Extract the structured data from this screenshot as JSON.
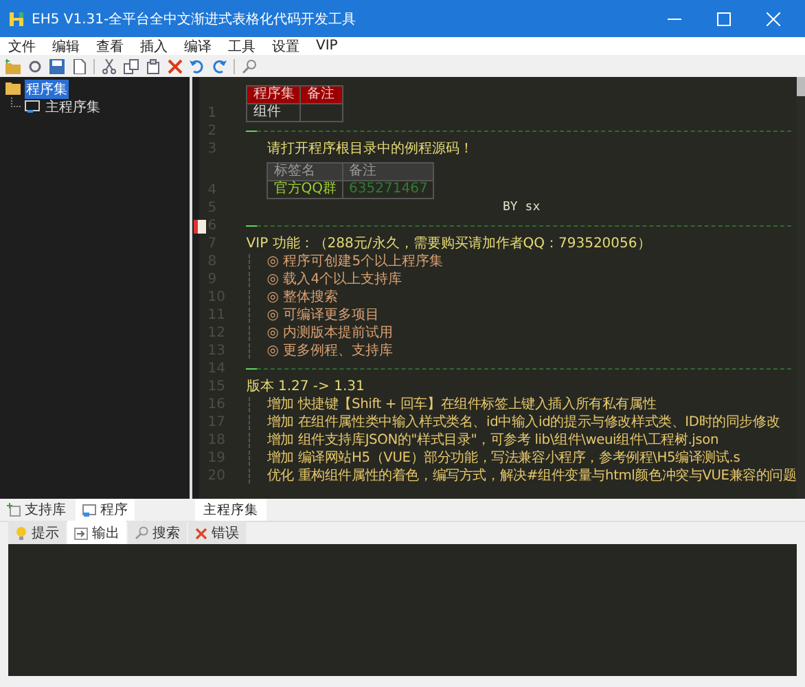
{
  "window": {
    "title": "EH5 V1.31-全平台全中文渐进式表格化代码开发工具"
  },
  "menu": [
    "文件",
    "编辑",
    "查看",
    "插入",
    "编译",
    "工具",
    "设置",
    "VIP"
  ],
  "tree": [
    {
      "label": "程序集",
      "selected": true,
      "children": [
        {
          "label": "主程序集",
          "selected": false
        }
      ]
    }
  ],
  "left_tabs": [
    {
      "label": "支持库",
      "kind": "library",
      "selected": false
    },
    {
      "label": "程序",
      "kind": "program",
      "selected": true
    }
  ],
  "editor_tabs": [
    {
      "label": "主程序集",
      "selected": true
    }
  ],
  "editor": {
    "lines": [
      {
        "kind": "table",
        "number": "1",
        "header": [
          "程序集",
          "备注"
        ],
        "rows": [
          [
            "组件"
          ]
        ]
      },
      {
        "kind": "divider",
        "number": "2",
        "bookmark": false
      },
      {
        "kind": "note",
        "number": "3",
        "text": "请打开程序根目录中的例程源码！"
      },
      {
        "kind": "tag_table",
        "number": "4",
        "header": [
          "标签名",
          "备注"
        ],
        "rows": [
          [
            "官方QQ群",
            "635271467"
          ]
        ]
      },
      {
        "kind": "center",
        "number": "5",
        "text": "BY sx"
      },
      {
        "kind": "divider",
        "number": "6",
        "bookmark": true
      },
      {
        "kind": "heading",
        "number": "7",
        "text": "VIP 功能：（288元/永久，需要购买请加作者QQ：793520056）"
      },
      {
        "kind": "bullet",
        "number": "8",
        "text": "◎ 程序可创建5个以上程序集"
      },
      {
        "kind": "bullet",
        "number": "9",
        "text": "◎ 载入4个以上支持库"
      },
      {
        "kind": "bullet",
        "number": "10",
        "text": "◎ 整体搜索"
      },
      {
        "kind": "bullet",
        "number": "11",
        "text": "◎ 可编译更多项目"
      },
      {
        "kind": "bullet",
        "number": "12",
        "text": "◎ 内测版本提前试用"
      },
      {
        "kind": "bullet",
        "number": "13",
        "text": "◎ 更多例程、支持库"
      },
      {
        "kind": "divider",
        "number": "14",
        "bookmark": false
      },
      {
        "kind": "heading",
        "number": "15",
        "text": "版本 1.27 -> 1.31"
      },
      {
        "kind": "item",
        "number": "16",
        "text": "增加 快捷键【Shift + 回车】在组件标签上键入插入所有私有属性"
      },
      {
        "kind": "item",
        "number": "17",
        "text": "增加 在组件属性类中输入样式类名、id中输入id的提示与修改样式类、ID时的同步修改"
      },
      {
        "kind": "item",
        "number": "18",
        "text": "增加 组件支持库JSON的\"样式目录\"，可参考 lib\\组件\\weui组件\\工程树.json"
      },
      {
        "kind": "item",
        "number": "19",
        "text": "增加 编译网站H5（VUE）部分功能，写法兼容小程序，参考例程\\H5编译测试.s"
      },
      {
        "kind": "item",
        "number": "20",
        "text": "优化 重构组件属性的着色，编写方式，解决#组件变量与html颜色冲突与VUE兼容的问题"
      }
    ]
  },
  "output_tabs": [
    {
      "label": "提示",
      "kind": "hint",
      "selected": false
    },
    {
      "label": "输出",
      "kind": "output",
      "selected": true
    },
    {
      "label": "搜索",
      "kind": "search",
      "selected": false
    },
    {
      "label": "错误",
      "kind": "error",
      "selected": false
    }
  ]
}
